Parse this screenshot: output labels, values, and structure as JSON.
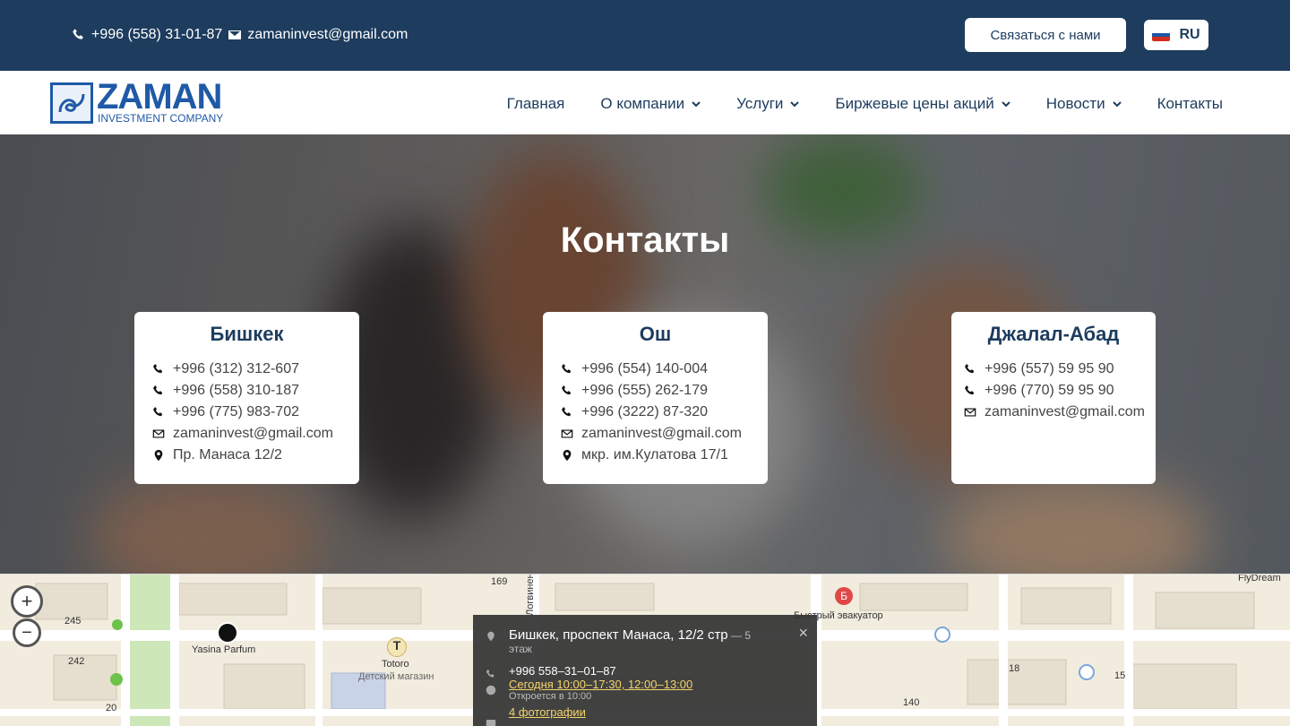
{
  "topbar": {
    "phone": "+996 (558) 31-01-87",
    "email": "zamaninvest@gmail.com",
    "contact_button": "Связаться с нами",
    "language": "RU"
  },
  "logo": {
    "name": "ZAMAN",
    "sub": "INVESTMENT COMPANY"
  },
  "nav": {
    "items": [
      {
        "label": "Главная"
      },
      {
        "label": "О компании"
      },
      {
        "label": "Услуги"
      },
      {
        "label": "Биржевые цены акций"
      },
      {
        "label": "Новости"
      },
      {
        "label": "Контакты"
      }
    ]
  },
  "hero": {
    "title": "Контакты"
  },
  "cards": [
    {
      "city": "Бишкек",
      "phones": [
        "+996 (312) 312-607",
        "+996 (558) 310-187",
        "+996 (775) 983-702"
      ],
      "email": "zamaninvest@gmail.com",
      "address": "Пр. Манаса 12/2"
    },
    {
      "city": "Ош",
      "phones": [
        "+996 (554) 140-004",
        "+996 (555) 262-179",
        "+996 (3222) 87-320"
      ],
      "email": "zamaninvest@gmail.com",
      "address": "мкр. им.Кулатова 17/1"
    },
    {
      "city": "Джалал-Абад",
      "phones": [
        "+996 (557) 59 95 90",
        "+996 (770) 59 95 90"
      ],
      "email": "zamaninvest@gmail.com",
      "address": ""
    }
  ],
  "map": {
    "zoom_in": "+",
    "zoom_out": "−",
    "labels": {
      "yasina": "Yasina Parfum",
      "totoro": "Totoro",
      "totoro_sub": "Детский магазин",
      "evacuator": "Быстрый эвакуатор",
      "flydream": "FlyDream",
      "n245": "245",
      "n242": "242",
      "n20": "20",
      "n169": "169",
      "n18": "18",
      "n15": "15",
      "n140": "140",
      "street": "Логвиненко"
    },
    "popup": {
      "address": "Бишкек, проспект Манаса, 12/2 стр",
      "floor_dash": " — 5",
      "floor": "этаж",
      "phone": "+996 558–31–01–87",
      "hours": "Сегодня 10:00–17:30, 12:00–13:00",
      "opens": "Откроется в 10:00",
      "photos": "4 фотографии",
      "close": "×"
    }
  }
}
